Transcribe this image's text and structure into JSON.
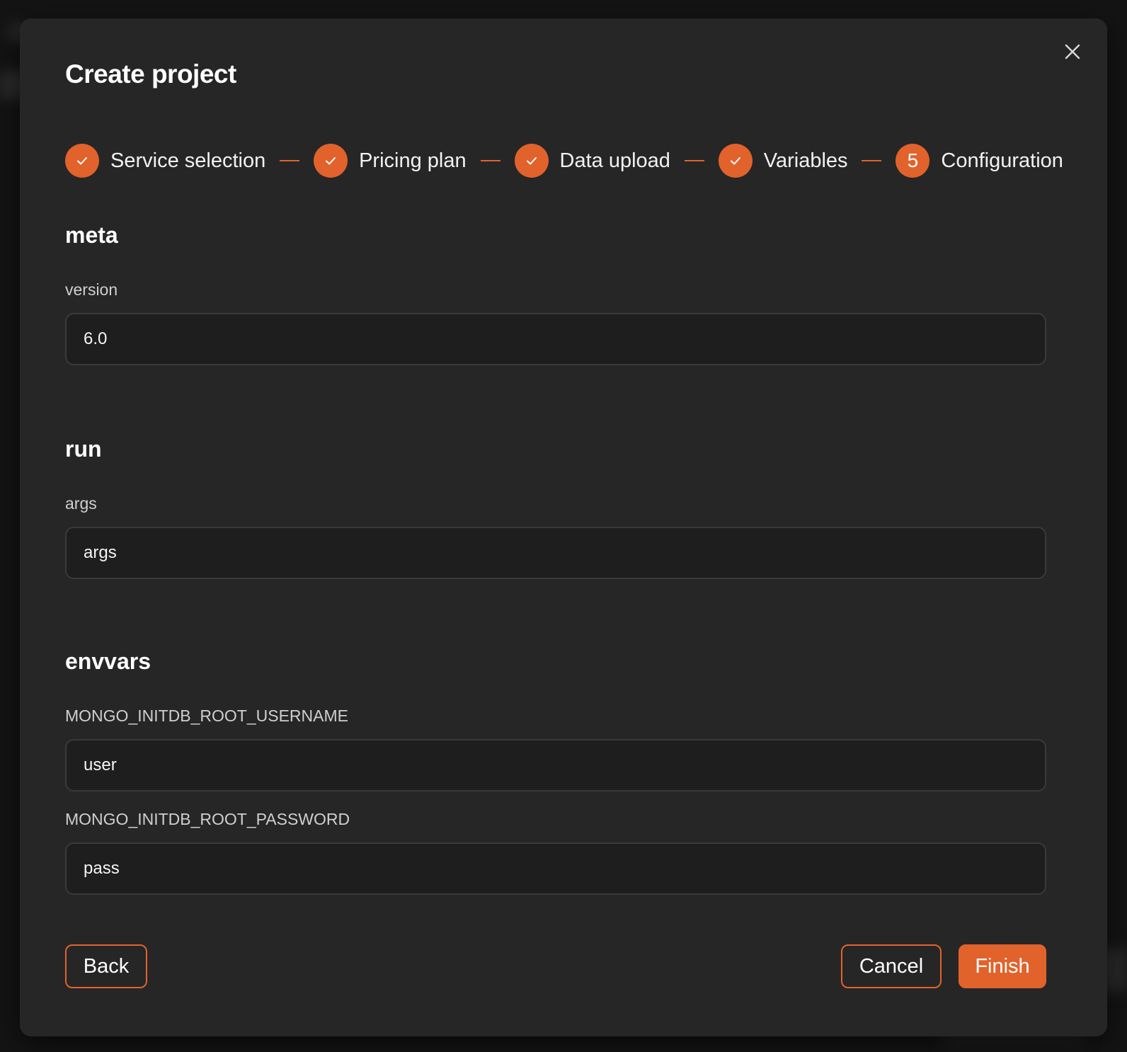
{
  "colors": {
    "accent": "#e2622c",
    "modal_bg": "#262626",
    "input_bg": "#1e1e1e"
  },
  "dialog": {
    "title": "Create project",
    "close_icon": "close-icon"
  },
  "stepper": {
    "steps": [
      {
        "label": "Service selection",
        "state": "completed",
        "icon": "check-icon"
      },
      {
        "label": "Pricing plan",
        "state": "completed",
        "icon": "check-icon"
      },
      {
        "label": "Data upload",
        "state": "completed",
        "icon": "check-icon"
      },
      {
        "label": "Variables",
        "state": "completed",
        "icon": "check-icon"
      },
      {
        "label": "Configuration",
        "state": "current",
        "number": "5"
      }
    ]
  },
  "sections": {
    "meta": {
      "heading": "meta",
      "fields": [
        {
          "label": "version",
          "value": "6.0"
        }
      ]
    },
    "run": {
      "heading": "run",
      "fields": [
        {
          "label": "args",
          "value": "args"
        }
      ]
    },
    "envvars": {
      "heading": "envvars",
      "fields": [
        {
          "label": "MONGO_INITDB_ROOT_USERNAME",
          "value": "user"
        },
        {
          "label": "MONGO_INITDB_ROOT_PASSWORD",
          "value": "pass"
        }
      ]
    }
  },
  "footer": {
    "back_label": "Back",
    "cancel_label": "Cancel",
    "finish_label": "Finish"
  }
}
